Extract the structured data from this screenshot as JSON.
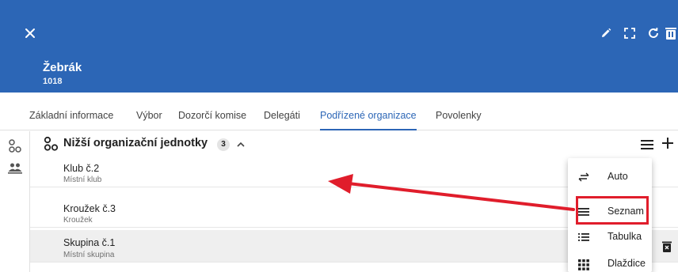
{
  "header": {
    "title": "Žebrák",
    "subtitle": "1018",
    "background": "#2c66b6",
    "icons": [
      "close-icon",
      "pencil-icon",
      "fullscreen-icon",
      "refresh-icon",
      "delete-icon"
    ]
  },
  "tabs": [
    {
      "label": "Základní informace"
    },
    {
      "label": "Výbor"
    },
    {
      "label": "Dozorčí komise"
    },
    {
      "label": "Delegáti"
    },
    {
      "label": "Podřízené organizace",
      "active": true
    },
    {
      "label": "Povolenky"
    }
  ],
  "section": {
    "title": "Nižší organizační jednotky",
    "count": "3"
  },
  "rows": [
    {
      "title": "Klub č.2",
      "subtitle": "Místní klub"
    },
    {
      "title": "Kroužek č.3",
      "subtitle": "Kroužek"
    },
    {
      "title": "Skupina č.1",
      "subtitle": "Místní skupina",
      "selected": true
    }
  ],
  "view_menu": {
    "items": [
      {
        "label": "Auto",
        "icon": "swap-arrows-icon"
      },
      {
        "label": "Seznam",
        "icon": "list-icon",
        "highlighted": true
      },
      {
        "label": "Tabulka",
        "icon": "table-list-icon"
      },
      {
        "label": "Dlaždice",
        "icon": "grid-icon"
      }
    ]
  },
  "colors": {
    "accent": "#2c66b6",
    "annotation": "#e01d2b"
  }
}
